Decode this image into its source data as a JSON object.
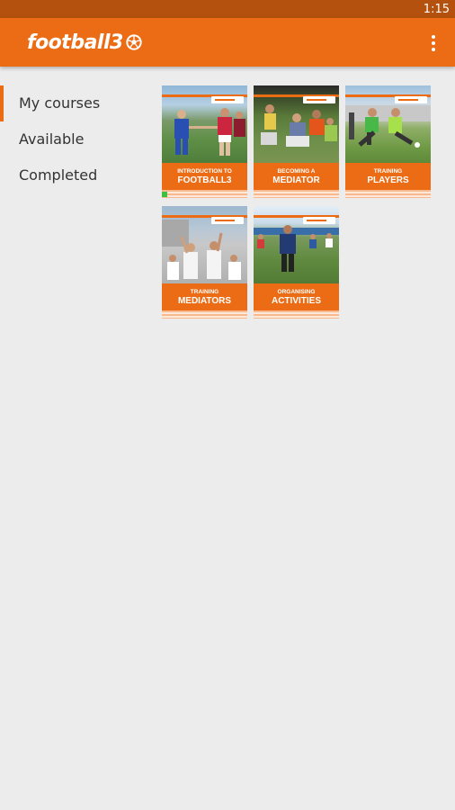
{
  "status_bar": {
    "time": "1:15"
  },
  "app_bar": {
    "logo_text": "football3",
    "logo_icon": "soccer-ball-icon",
    "menu_icon": "overflow-menu-icon"
  },
  "colors": {
    "brand_orange": "#ec6c16",
    "status_bar": "#b4510e",
    "background": "#ececec",
    "progress_green": "#3fbf3f"
  },
  "nav": {
    "items": [
      {
        "label": "My courses",
        "active": true
      },
      {
        "label": "Available",
        "active": false
      },
      {
        "label": "Completed",
        "active": false
      }
    ]
  },
  "courses": [
    {
      "line1": "INTRODUCTION TO",
      "line2": "FOOTBALL3"
    },
    {
      "line1": "BECOMING A",
      "line2": "MEDIATOR"
    },
    {
      "line1": "TRAINING",
      "line2": "PLAYERS"
    },
    {
      "line1": "TRAINING",
      "line2": "MEDIATORS"
    },
    {
      "line1": "ORGANISING",
      "line2": "ACTIVITIES"
    }
  ]
}
